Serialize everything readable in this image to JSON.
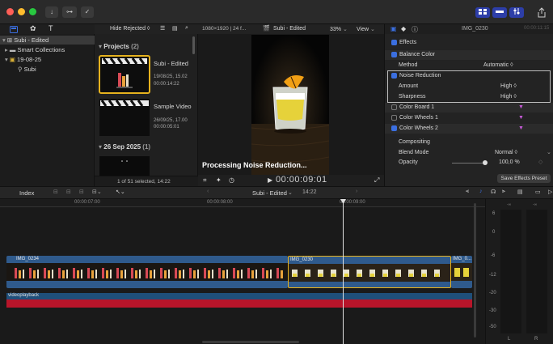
{
  "titlebar": {
    "download_label": "↓",
    "key_label": "⊶",
    "check_label": "✓"
  },
  "library": {
    "items": [
      {
        "label": "Subi - Edited"
      },
      {
        "label": "Smart Collections"
      },
      {
        "label": "19-08-25"
      },
      {
        "label": "Subi"
      }
    ]
  },
  "browser": {
    "filter": "Hide Rejected",
    "filter_chevron": "◊",
    "projects_label": "Projects",
    "projects_count": "(2)",
    "clips": [
      {
        "title": "Subi - Edited",
        "date": "19/08/25, 15.02",
        "duration": "00:00:14:22"
      },
      {
        "title": "Sample Video",
        "date": "26/09/25, 17.00",
        "duration": "00:00:05:01"
      }
    ],
    "group_label": "26 Sep 2025",
    "group_count": "(1)",
    "status": "1 of 51 selected, 14:22"
  },
  "viewer": {
    "format": "1080×1920 | 24 f...",
    "project": "Subi - Edited",
    "zoom": "33%",
    "view": "View",
    "processing": "Processing Noise Reduction...",
    "timecode": "00:00:09:01"
  },
  "inspector": {
    "clip_name": "IMG_0230",
    "clip_time": "00:00:11:15",
    "effects_label": "Effects",
    "balance_color": "Balance Color",
    "method_label": "Method",
    "method_value": "Automatic",
    "noise_reduction": "Noise Reduction",
    "amount_label": "Amount",
    "amount_value": "High",
    "sharpness_label": "Sharpness",
    "sharpness_value": "High",
    "color_board": "Color Board 1",
    "color_wheels_1": "Color Wheels 1",
    "color_wheels_2": "Color Wheels 2",
    "compositing": "Compositing",
    "blend_mode_label": "Blend Mode",
    "blend_mode_value": "Normal",
    "opacity_label": "Opacity",
    "opacity_value": "100,0",
    "opacity_unit": "%",
    "save_preset": "Save Effects Preset"
  },
  "timeline": {
    "index_label": "Index",
    "project_name": "Subi - Edited",
    "project_duration": "14:22",
    "ruler": [
      "00:00:07:00",
      "00:00:08:00",
      "00:00:09:00"
    ],
    "clips": [
      {
        "name": "IMG_0234"
      },
      {
        "name": "IMG_0230"
      },
      {
        "name": "IMG_0..."
      }
    ],
    "audio_label": "videoplayback"
  },
  "meters": {
    "scale": [
      "6",
      "0",
      "-6",
      "-12",
      "-20",
      "-30",
      "-50"
    ],
    "peak": "-∞",
    "left": "L",
    "right": "R"
  },
  "colors": {
    "accent": "#3b6fe0",
    "video_track": "#2f5a8c",
    "audio_track": "#1f4f7a",
    "red_track": "#b8152a"
  }
}
